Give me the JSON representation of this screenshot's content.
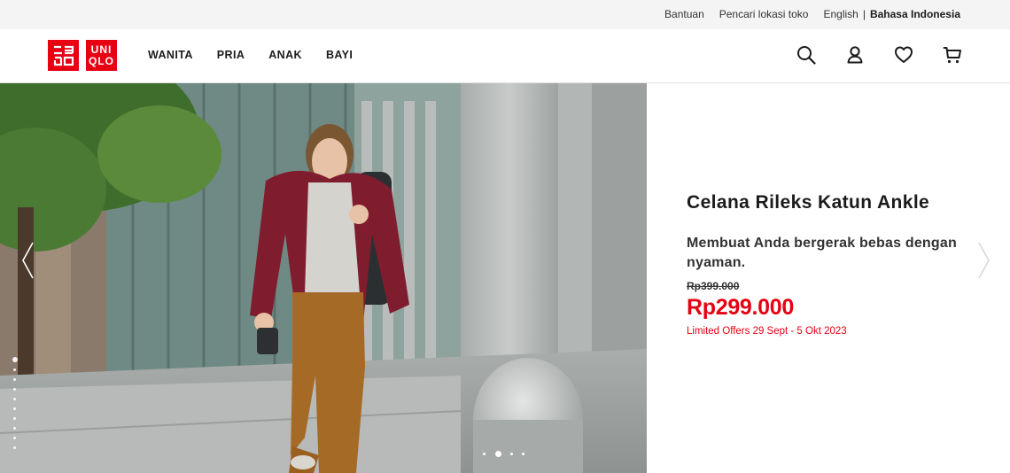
{
  "utility_bar": {
    "help": "Bantuan",
    "store_locator": "Pencari lokasi toko",
    "lang_english": "English",
    "lang_separator": "|",
    "lang_indonesia": "Bahasa Indonesia"
  },
  "header": {
    "logo": {
      "tile_left_text": "ユニクロ",
      "tile_right_line1": "UNI",
      "tile_right_line2": "QLO",
      "brand_color": "#e60012"
    },
    "nav": [
      {
        "label": "WANITA"
      },
      {
        "label": "PRIA"
      },
      {
        "label": "ANAK"
      },
      {
        "label": "BAYI"
      }
    ],
    "icons": [
      "search-icon",
      "account-icon",
      "wishlist-heart-icon",
      "cart-icon"
    ]
  },
  "hero": {
    "product_title": "Celana Rileks Katun Ankle",
    "description": "Membuat Anda bergerak bebas dengan nyaman.",
    "price_old": "Rp399.000",
    "price_new": "Rp299.000",
    "offer_note": "Limited Offers 29 Sept - 5 Okt 2023",
    "accent_color": "#e60012",
    "slider": {
      "horizontal_slides": 4,
      "horizontal_active": 2,
      "vertical_slides": 10,
      "vertical_active": 1
    }
  }
}
